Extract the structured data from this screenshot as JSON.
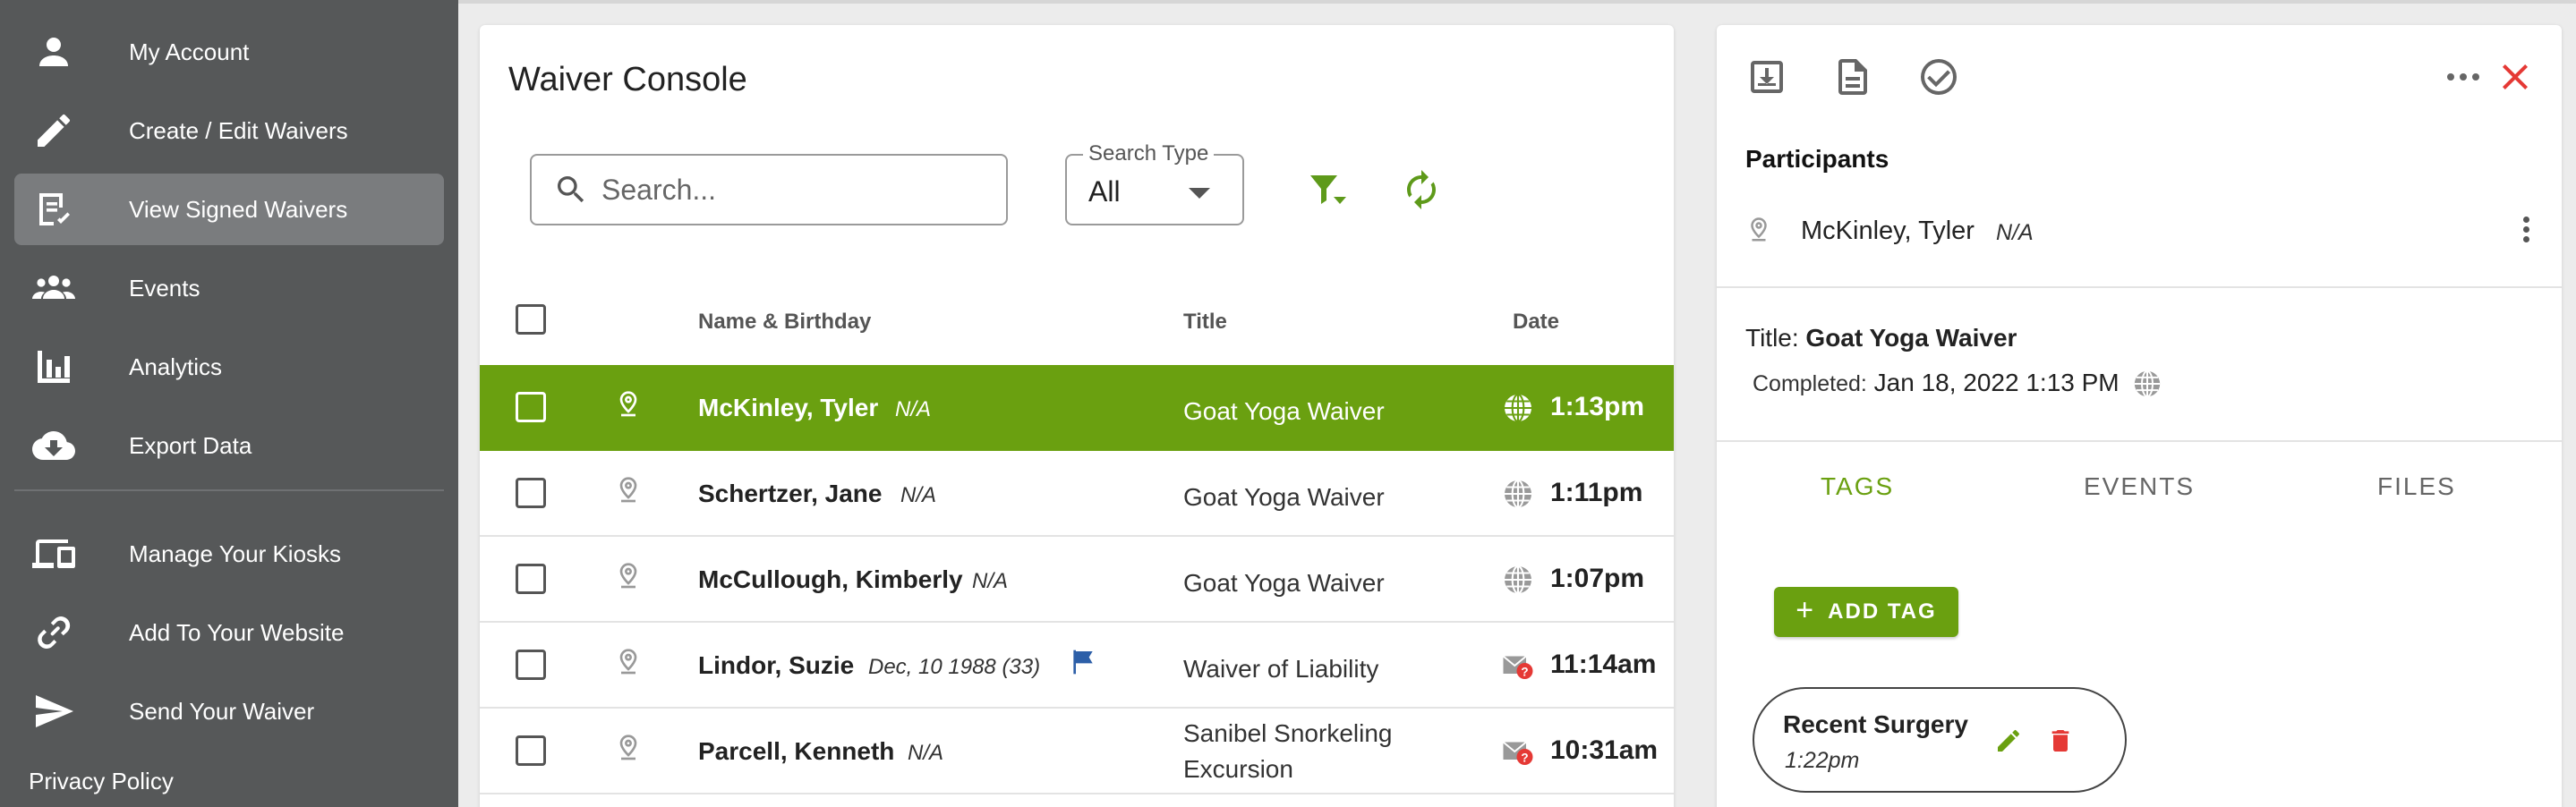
{
  "sidebar": {
    "items": [
      {
        "label": "My Account",
        "icon": "person-icon"
      },
      {
        "label": "Create / Edit Waivers",
        "icon": "pencil-icon"
      },
      {
        "label": "View Signed Waivers",
        "icon": "signed-document-icon"
      },
      {
        "label": "Events",
        "icon": "group-icon"
      },
      {
        "label": "Analytics",
        "icon": "bar-chart-icon"
      },
      {
        "label": "Export Data",
        "icon": "cloud-download-icon"
      },
      {
        "label": "Manage Your Kiosks",
        "icon": "devices-icon"
      },
      {
        "label": "Add To Your Website",
        "icon": "link-icon"
      },
      {
        "label": "Send Your Waiver",
        "icon": "send-icon"
      }
    ],
    "privacy_label": "Privacy Policy",
    "active_index": 2
  },
  "console": {
    "title": "Waiver Console",
    "search": {
      "placeholder": "Search...",
      "value": ""
    },
    "search_type": {
      "legend": "Search Type",
      "value": "All"
    },
    "columns": {
      "name": "Name & Birthday",
      "title": "Title",
      "date": "Date"
    },
    "rows": [
      {
        "name": "McKinley, Tyler",
        "dob": "N/A",
        "title": "Goat Yoga Waiver",
        "time": "1:13pm",
        "source_icon": "globe-icon",
        "selected": true
      },
      {
        "name": "Schertzer, Jane",
        "dob": "N/A",
        "title": "Goat Yoga Waiver",
        "time": "1:11pm",
        "source_icon": "globe-icon",
        "selected": false
      },
      {
        "name": "McCullough, Kimberly",
        "dob": "N/A",
        "title": "Goat Yoga Waiver",
        "time": "1:07pm",
        "source_icon": "globe-icon",
        "selected": false
      },
      {
        "name": "Lindor, Suzie",
        "dob": "Dec, 10 1988 (33)",
        "title": "Waiver of Liability",
        "time": "11:14am",
        "source_icon": "email-question-icon",
        "flagged": true,
        "selected": false
      },
      {
        "name": "Parcell, Kenneth",
        "dob": "N/A",
        "title": "Sanibel Snorkeling Excursion",
        "time": "10:31am",
        "source_icon": "email-question-icon",
        "selected": false
      }
    ]
  },
  "detail": {
    "participants_label": "Participants",
    "participant": {
      "name": "McKinley, Tyler",
      "dob": "N/A"
    },
    "title_label": "Title:",
    "title_value": "Goat Yoga Waiver",
    "completed_label": "Completed:",
    "completed_value": "Jan 18, 2022 1:13 PM",
    "tabs": [
      "TAGS",
      "EVENTS",
      "FILES"
    ],
    "active_tab": 0,
    "add_tag_label": "ADD TAG",
    "tag": {
      "name": "Recent Surgery",
      "time": "1:22pm"
    }
  },
  "colors": {
    "accent": "#6aa010",
    "sidebar_bg": "#565859",
    "close": "#e53935",
    "delete": "#e53935"
  }
}
